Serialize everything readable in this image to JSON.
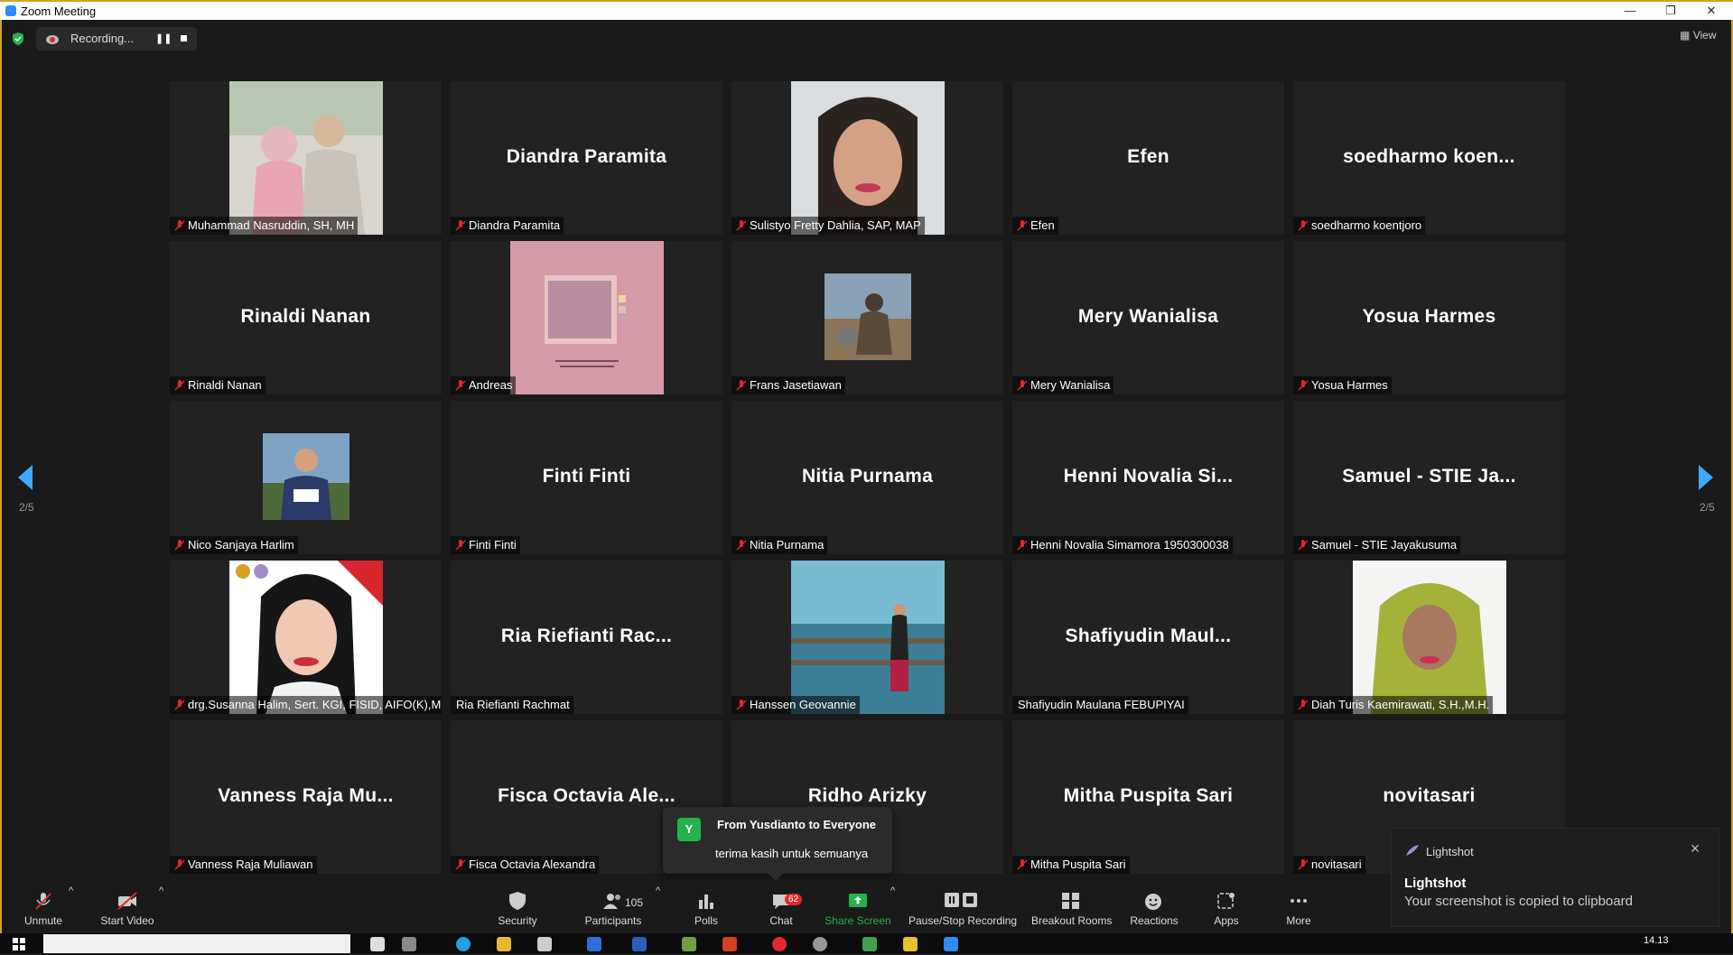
{
  "window": {
    "title": "Zoom Meeting"
  },
  "recording": {
    "label": "Recording..."
  },
  "view_button": {
    "label": "View"
  },
  "pagination": {
    "left": "2/5",
    "right": "2/5"
  },
  "tiles": [
    {
      "display": "photo",
      "label": "Muhammad Nasruddin, SH, MH",
      "muted": true
    },
    {
      "display": "name",
      "big": "Diandra Paramita",
      "label": "Diandra Paramita",
      "muted": true
    },
    {
      "display": "photo",
      "label": "Sulistyo Fretty Dahlia, SAP, MAP",
      "muted": true
    },
    {
      "display": "name",
      "big": "Efen",
      "label": "Efen",
      "muted": true
    },
    {
      "display": "name",
      "big": "soedharmo koen...",
      "label": "soedharmo koentjoro",
      "muted": true
    },
    {
      "display": "name",
      "big": "Rinaldi Nanan",
      "label": "Rinaldi Nanan",
      "muted": true
    },
    {
      "display": "photo",
      "label": "Andreas",
      "muted": true
    },
    {
      "display": "photo",
      "label": "Frans Jasetiawan",
      "muted": true
    },
    {
      "display": "name",
      "big": "Mery Wanialisa",
      "label": "Mery Wanialisa",
      "muted": true
    },
    {
      "display": "name",
      "big": "Yosua Harmes",
      "label": "Yosua Harmes",
      "muted": true
    },
    {
      "display": "photo",
      "label": "Nico Sanjaya Harlim",
      "muted": true
    },
    {
      "display": "name",
      "big": "Finti Finti",
      "label": "Finti Finti",
      "muted": true
    },
    {
      "display": "name",
      "big": "Nitia Purnama",
      "label": "Nitia Purnama",
      "muted": true
    },
    {
      "display": "name",
      "big": "Henni Novalia Si...",
      "label": "Henni Novalia Simamora 1950300038",
      "muted": true
    },
    {
      "display": "name",
      "big": "Samuel - STIE Ja...",
      "label": "Samuel - STIE Jayakusuma",
      "muted": true
    },
    {
      "display": "photo",
      "label": "drg.Susanna Halim, Sert. KGI, FISID, AIFO(K),M....",
      "muted": true
    },
    {
      "display": "name",
      "big": "Ria Riefianti Rac...",
      "label": "Ria Riefianti Rachmat",
      "muted": false
    },
    {
      "display": "photo",
      "label": "Hanssen Geovannie",
      "muted": true
    },
    {
      "display": "name",
      "big": "Shafiyudin Maul...",
      "label": "Shafiyudin Maulana FEBUPIYAI",
      "muted": false
    },
    {
      "display": "photo",
      "label": "Diah Turis Kaemirawati, S.H.,M.H.",
      "muted": true
    },
    {
      "display": "name",
      "big": "Vanness Raja Mu...",
      "label": "Vanness Raja Muliawan",
      "muted": true
    },
    {
      "display": "name",
      "big": "Fisca Octavia Ale...",
      "label": "Fisca Octavia Alexandra",
      "muted": true
    },
    {
      "display": "name",
      "big": "Ridho Arizky",
      "label": "",
      "muted": false
    },
    {
      "display": "name",
      "big": "Mitha Puspita Sari",
      "label": "Mitha Puspita Sari",
      "muted": true
    },
    {
      "display": "name",
      "big": "novitasari",
      "label": "novitasari",
      "muted": true
    }
  ],
  "chat_popup": {
    "avatar_letter": "Y",
    "from": "From Yusdianto to Everyone",
    "message": "terima kasih untuk semuanya"
  },
  "toolbar": {
    "unmute": "Unmute",
    "start_video": "Start Video",
    "security": "Security",
    "participants": "Participants",
    "participants_count": "105",
    "polls": "Polls",
    "chat": "Chat",
    "chat_badge": "62",
    "share_screen": "Share Screen",
    "pause_stop": "Pause/Stop Recording",
    "breakout": "Breakout Rooms",
    "reactions": "Reactions",
    "apps": "Apps",
    "more": "More"
  },
  "toast": {
    "app": "Lightshot",
    "title": "Lightshot",
    "body": "Your screenshot is copied to clipboard"
  },
  "taskbar": {
    "clock": "14.13"
  },
  "colors": {
    "accent_blue": "#3fa8ff",
    "share_green": "#24b24c",
    "muted_red": "#e02828",
    "window_border": "#d4a51f"
  }
}
